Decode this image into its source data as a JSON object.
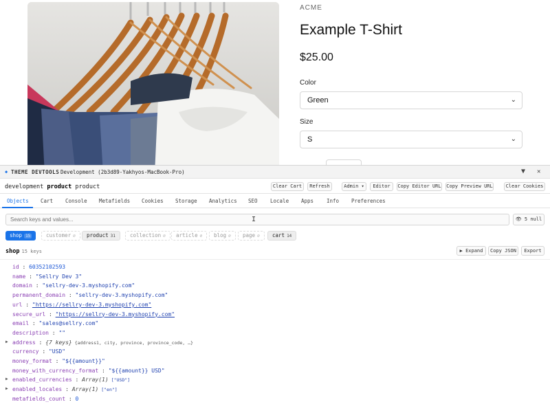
{
  "store": {
    "vendor": "ACME",
    "title": "Example T-Shirt",
    "price": "$25.00",
    "options": [
      {
        "label": "Color",
        "value": "Green"
      },
      {
        "label": "Size",
        "value": "S"
      }
    ]
  },
  "devtools": {
    "brand": "THEME DEVTOOLS",
    "environment": "Development (2b3d89-Yakhyos-MacBook-Pro)",
    "context": {
      "env": "development",
      "template": "product",
      "type": "product"
    },
    "actions": [
      "Clear Cart",
      "Refresh",
      "Admin ▾",
      "Editor",
      "Copy Editor URL",
      "Copy Preview URL",
      "Clear Cookies"
    ],
    "tabs": [
      "Objects",
      "Cart",
      "Console",
      "Metafields",
      "Cookies",
      "Storage",
      "Analytics",
      "SEO",
      "Locale",
      "Apps",
      "Info",
      "Preferences"
    ],
    "active_tab": "Objects",
    "search_placeholder": "Search keys and values...",
    "null_toggle": "5 null",
    "chips": [
      {
        "label": "shop",
        "count": "15",
        "state": "active"
      },
      {
        "label": "customer",
        "count": "∅",
        "state": "empty"
      },
      {
        "label": "product",
        "count": "31",
        "state": "filled"
      },
      {
        "label": "collection",
        "count": "∅",
        "state": "empty"
      },
      {
        "label": "article",
        "count": "∅",
        "state": "empty"
      },
      {
        "label": "blog",
        "count": "∅",
        "state": "empty"
      },
      {
        "label": "page",
        "count": "∅",
        "state": "empty"
      },
      {
        "label": "cart",
        "count": "14",
        "state": "filled"
      }
    ],
    "section": {
      "name": "shop",
      "keys": "15 keys"
    },
    "section_actions": [
      "▶ Expand",
      "Copy JSON",
      "Export"
    ],
    "rows": [
      {
        "key": "id",
        "value": "60352102593",
        "kind": "num"
      },
      {
        "key": "name",
        "value": "\"Sellry Dev 3\"",
        "kind": "str"
      },
      {
        "key": "domain",
        "value": "\"sellry-dev-3.myshopify.com\"",
        "kind": "str"
      },
      {
        "key": "permanent_domain",
        "value": "\"sellry-dev-3.myshopify.com\"",
        "kind": "str"
      },
      {
        "key": "url",
        "value": "\"https://sellry-dev-3.myshopify.com\"",
        "kind": "url"
      },
      {
        "key": "secure_url",
        "value": "\"https://sellry-dev-3.myshopify.com\"",
        "kind": "url"
      },
      {
        "key": "email",
        "value": "\"sales@sellry.com\"",
        "kind": "str"
      },
      {
        "key": "description",
        "value": "\"\"",
        "kind": "str"
      },
      {
        "key": "address",
        "value": "{7 keys}",
        "kind": "meta",
        "expandable": true,
        "preview": "{address1, city, province, province_code, …}"
      },
      {
        "key": "currency",
        "value": "\"USD\"",
        "kind": "str"
      },
      {
        "key": "money_format",
        "value": "\"${{amount}}\"",
        "kind": "str"
      },
      {
        "key": "money_with_currency_format",
        "value": "\"${{amount}} USD\"",
        "kind": "str"
      },
      {
        "key": "enabled_currencies",
        "value": "Array(1)",
        "kind": "meta",
        "expandable": true,
        "preview": "[\"USD\"]"
      },
      {
        "key": "enabled_locales",
        "value": "Array(1)",
        "kind": "meta",
        "expandable": true,
        "preview": "[\"en\"]"
      },
      {
        "key": "metafields_count",
        "value": "0",
        "kind": "num"
      }
    ]
  }
}
